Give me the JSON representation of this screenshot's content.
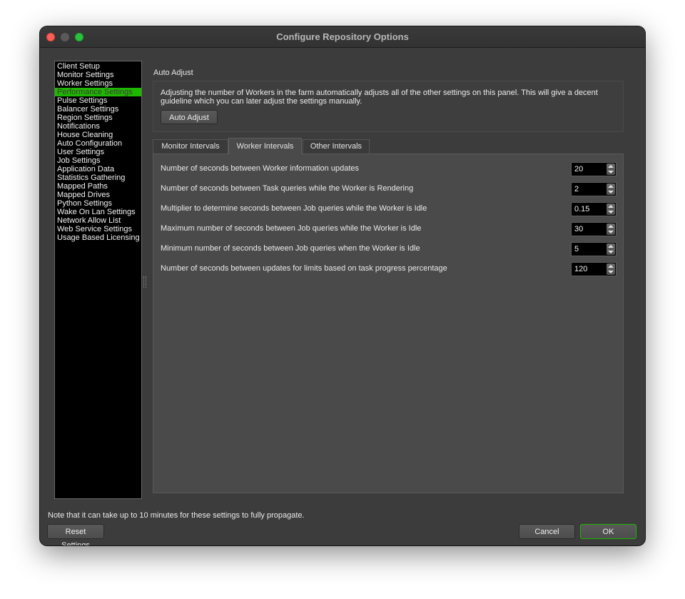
{
  "window": {
    "title": "Configure Repository Options"
  },
  "sidebar": {
    "items": [
      {
        "label": "Client Setup"
      },
      {
        "label": "Monitor Settings"
      },
      {
        "label": "Worker Settings"
      },
      {
        "label": "Performance Settings",
        "selected": true
      },
      {
        "label": "Pulse Settings"
      },
      {
        "label": "Balancer Settings"
      },
      {
        "label": "Region Settings"
      },
      {
        "label": "Notifications"
      },
      {
        "label": "House Cleaning"
      },
      {
        "label": "Auto Configuration"
      },
      {
        "label": "User Settings"
      },
      {
        "label": "Job Settings"
      },
      {
        "label": "Application Data"
      },
      {
        "label": "Statistics Gathering"
      },
      {
        "label": "Mapped Paths"
      },
      {
        "label": "Mapped Drives"
      },
      {
        "label": "Python Settings"
      },
      {
        "label": "Wake On Lan Settings"
      },
      {
        "label": "Network Allow List"
      },
      {
        "label": "Web Service Settings"
      },
      {
        "label": "Usage Based Licensing"
      }
    ],
    "selected_color": "#1fb800"
  },
  "auto_adjust": {
    "section_label": "Auto Adjust",
    "description": "Adjusting the number of Workers in the farm automatically adjusts all of the other settings on this panel. This will give a decent guideline which you can later adjust the settings manually.",
    "button_label": "Auto Adjust"
  },
  "tabs": [
    {
      "label": "Monitor Intervals"
    },
    {
      "label": "Worker Intervals",
      "active": true
    },
    {
      "label": "Other Intervals"
    }
  ],
  "worker_intervals": {
    "rows": [
      {
        "label": "Number of seconds between Worker information updates",
        "value": "20"
      },
      {
        "label": "Number of seconds between Task queries while the Worker is Rendering",
        "value": "2"
      },
      {
        "label": "Multiplier to determine seconds between Job queries while the Worker is Idle",
        "value": "0.15"
      },
      {
        "label": "Maximum number of seconds between Job queries while the Worker is Idle",
        "value": "30"
      },
      {
        "label": "Minimum number of seconds between Job queries when the Worker is Idle",
        "value": "5"
      },
      {
        "label": "Number of seconds between updates for limits based on task progress percentage",
        "value": "120"
      }
    ]
  },
  "footer": {
    "note": "Note that it can take up to 10 minutes for these settings to fully propagate.",
    "reset_label": "Reset Settings",
    "cancel_label": "Cancel",
    "ok_label": "OK"
  }
}
